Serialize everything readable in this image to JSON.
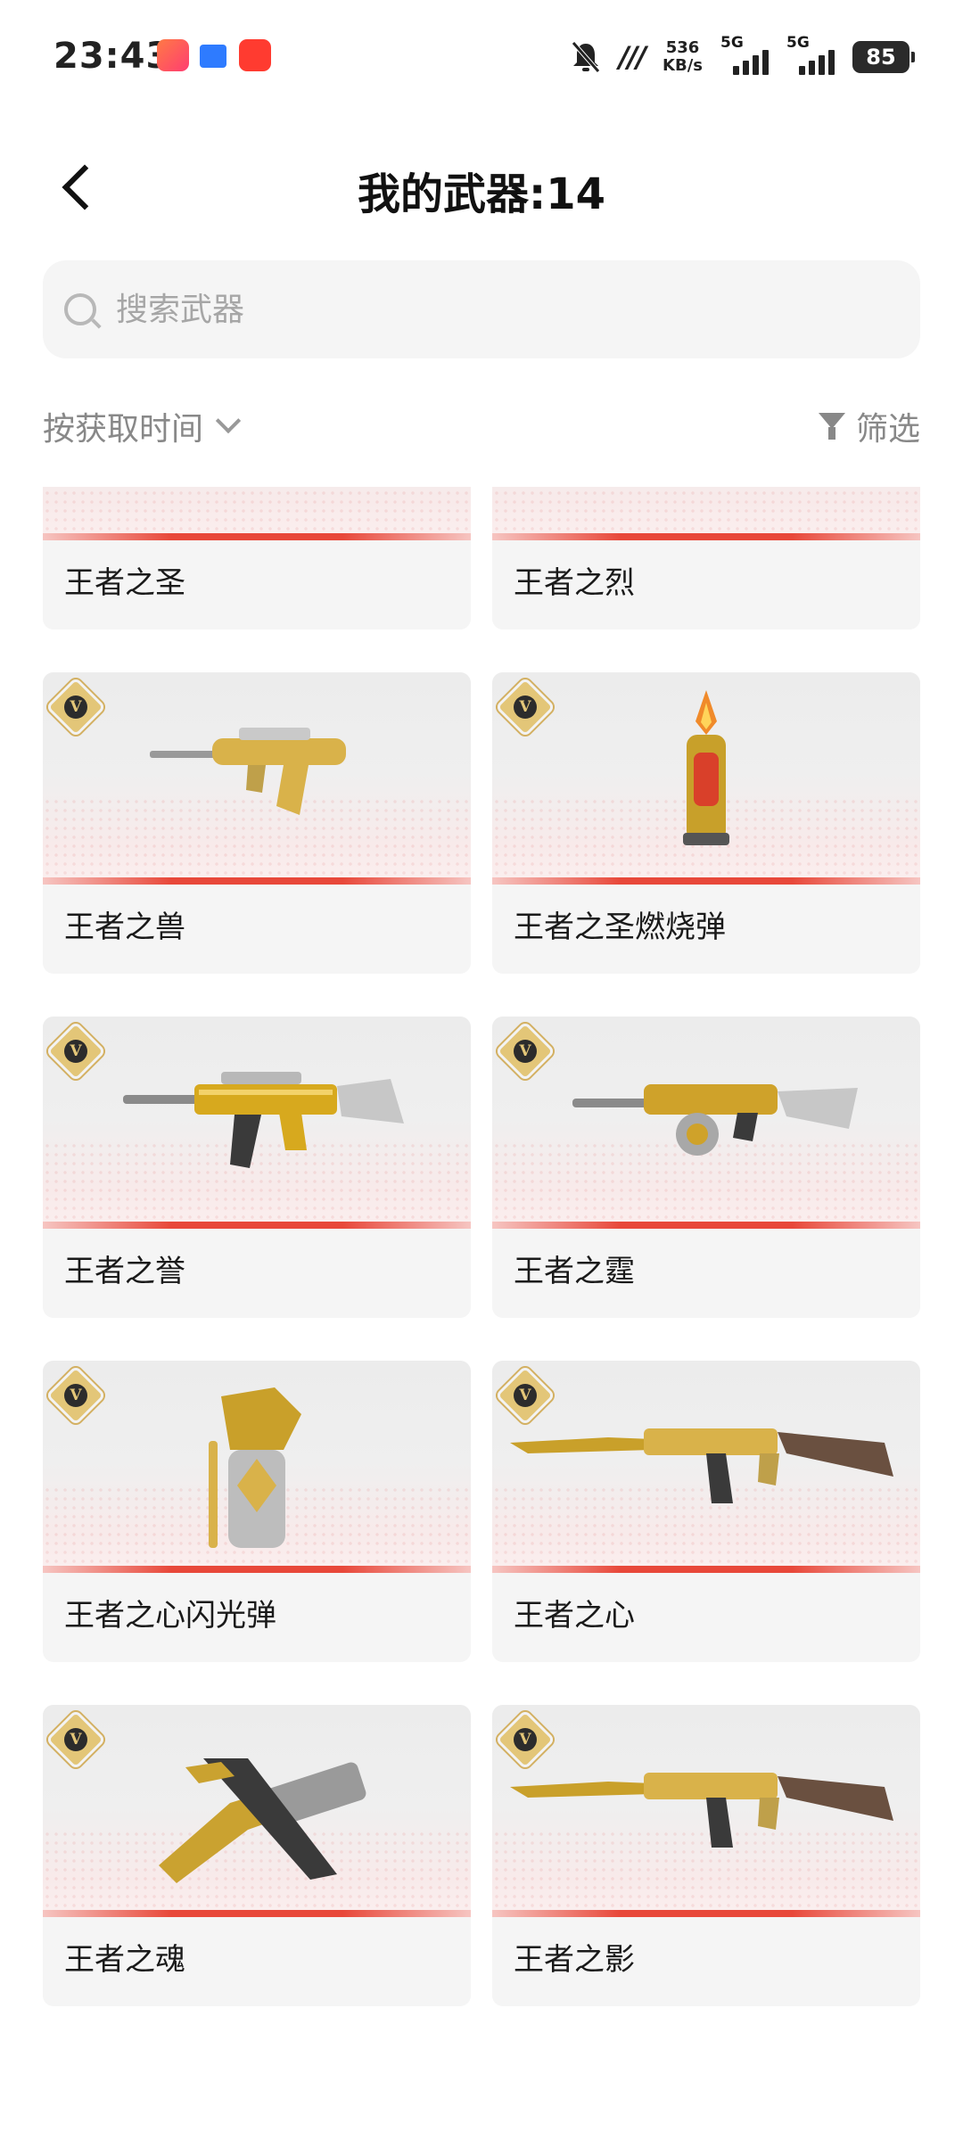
{
  "status_bar": {
    "time": "23:43",
    "net_speed_value": "536",
    "net_speed_unit": "KB/s",
    "sim1": "5G",
    "sim2": "5G",
    "battery": "85"
  },
  "header": {
    "title": "我的武器:14"
  },
  "search": {
    "placeholder": "搜索武器"
  },
  "toolbar": {
    "sort_label": "按获取时间",
    "filter_label": "筛选"
  },
  "badge_letter": "V",
  "colors": {
    "accent_red": "#e8483a",
    "gold": "#e3c678",
    "card_bg": "#f5f5f5"
  },
  "weapons": [
    {
      "name": "王者之圣",
      "icon": "assault-rifle"
    },
    {
      "name": "王者之烈",
      "icon": "tommy-gun"
    },
    {
      "name": "王者之兽",
      "icon": "bullpup-rifle"
    },
    {
      "name": "王者之圣燃烧弹",
      "icon": "incendiary-grenade"
    },
    {
      "name": "王者之誉",
      "icon": "assault-rifle"
    },
    {
      "name": "王者之霆",
      "icon": "drum-shotgun"
    },
    {
      "name": "王者之心闪光弹",
      "icon": "flash-grenade"
    },
    {
      "name": "王者之心",
      "icon": "ak-rifle"
    },
    {
      "name": "王者之魂",
      "icon": "pistol"
    },
    {
      "name": "王者之影",
      "icon": "ak-rifle"
    }
  ]
}
